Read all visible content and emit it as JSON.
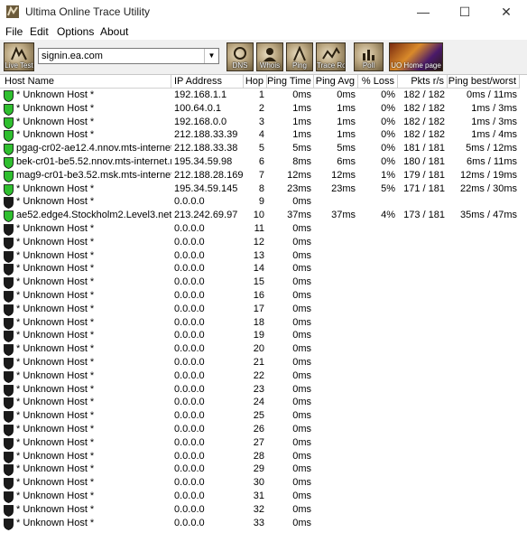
{
  "window": {
    "title": "Ultima Online Trace Utility"
  },
  "menu": [
    "File",
    "Edit",
    "Options",
    "About"
  ],
  "toolbar": {
    "buttons": [
      "Live Test",
      "DNS",
      "Whois",
      "Ping",
      "Trace Route",
      "Poll"
    ],
    "host_value": "signin.ea.com",
    "homepage_label": "UO Home page"
  },
  "columns": [
    "Host Name",
    "IP Address",
    "Hop",
    "Ping Time",
    "Ping Avg",
    "% Loss",
    "Pkts r/s",
    "Ping best/worst"
  ],
  "colors": {
    "status_ok": "#2fbf2f",
    "status_no": "#1a1a1a"
  },
  "rows": [
    {
      "status": "ok",
      "host": "* Unknown Host *",
      "ip": "192.168.1.1",
      "hop": "1",
      "time": "0ms",
      "avg": "0ms",
      "loss": "0%",
      "pkts": "182 / 182",
      "bw": "0ms / 11ms"
    },
    {
      "status": "ok",
      "host": "* Unknown Host *",
      "ip": "100.64.0.1",
      "hop": "2",
      "time": "1ms",
      "avg": "1ms",
      "loss": "0%",
      "pkts": "182 / 182",
      "bw": "1ms / 3ms"
    },
    {
      "status": "ok",
      "host": "* Unknown Host *",
      "ip": "192.168.0.0",
      "hop": "3",
      "time": "1ms",
      "avg": "1ms",
      "loss": "0%",
      "pkts": "182 / 182",
      "bw": "1ms / 3ms"
    },
    {
      "status": "ok",
      "host": "* Unknown Host *",
      "ip": "212.188.33.39",
      "hop": "4",
      "time": "1ms",
      "avg": "1ms",
      "loss": "0%",
      "pkts": "182 / 182",
      "bw": "1ms / 4ms"
    },
    {
      "status": "ok",
      "host": "pgag-cr02-ae12.4.nnov.mts-internet.net",
      "ip": "212.188.33.38",
      "hop": "5",
      "time": "5ms",
      "avg": "5ms",
      "loss": "0%",
      "pkts": "181 / 181",
      "bw": "5ms / 12ms"
    },
    {
      "status": "ok",
      "host": "bek-cr01-be5.52.nnov.mts-internet.net",
      "ip": "195.34.59.98",
      "hop": "6",
      "time": "8ms",
      "avg": "6ms",
      "loss": "0%",
      "pkts": "180 / 181",
      "bw": "6ms / 11ms"
    },
    {
      "status": "ok",
      "host": "mag9-cr01-be3.52.msk.mts-internet.net",
      "ip": "212.188.28.169",
      "hop": "7",
      "time": "12ms",
      "avg": "12ms",
      "loss": "1%",
      "pkts": "179 / 181",
      "bw": "12ms / 19ms"
    },
    {
      "status": "ok",
      "host": "* Unknown Host *",
      "ip": "195.34.59.145",
      "hop": "8",
      "time": "23ms",
      "avg": "23ms",
      "loss": "5%",
      "pkts": "171 / 181",
      "bw": "22ms / 30ms"
    },
    {
      "status": "no",
      "host": "* Unknown Host *",
      "ip": "0.0.0.0",
      "hop": "9",
      "time": "0ms",
      "avg": "",
      "loss": "",
      "pkts": "",
      "bw": ""
    },
    {
      "status": "ok",
      "host": "ae52.edge4.Stockholm2.Level3.net",
      "ip": "213.242.69.97",
      "hop": "10",
      "time": "37ms",
      "avg": "37ms",
      "loss": "4%",
      "pkts": "173 / 181",
      "bw": "35ms / 47ms"
    },
    {
      "status": "no",
      "host": "* Unknown Host *",
      "ip": "0.0.0.0",
      "hop": "11",
      "time": "0ms",
      "avg": "",
      "loss": "",
      "pkts": "",
      "bw": ""
    },
    {
      "status": "no",
      "host": "* Unknown Host *",
      "ip": "0.0.0.0",
      "hop": "12",
      "time": "0ms",
      "avg": "",
      "loss": "",
      "pkts": "",
      "bw": ""
    },
    {
      "status": "no",
      "host": "* Unknown Host *",
      "ip": "0.0.0.0",
      "hop": "13",
      "time": "0ms",
      "avg": "",
      "loss": "",
      "pkts": "",
      "bw": ""
    },
    {
      "status": "no",
      "host": "* Unknown Host *",
      "ip": "0.0.0.0",
      "hop": "14",
      "time": "0ms",
      "avg": "",
      "loss": "",
      "pkts": "",
      "bw": ""
    },
    {
      "status": "no",
      "host": "* Unknown Host *",
      "ip": "0.0.0.0",
      "hop": "15",
      "time": "0ms",
      "avg": "",
      "loss": "",
      "pkts": "",
      "bw": ""
    },
    {
      "status": "no",
      "host": "* Unknown Host *",
      "ip": "0.0.0.0",
      "hop": "16",
      "time": "0ms",
      "avg": "",
      "loss": "",
      "pkts": "",
      "bw": ""
    },
    {
      "status": "no",
      "host": "* Unknown Host *",
      "ip": "0.0.0.0",
      "hop": "17",
      "time": "0ms",
      "avg": "",
      "loss": "",
      "pkts": "",
      "bw": ""
    },
    {
      "status": "no",
      "host": "* Unknown Host *",
      "ip": "0.0.0.0",
      "hop": "18",
      "time": "0ms",
      "avg": "",
      "loss": "",
      "pkts": "",
      "bw": ""
    },
    {
      "status": "no",
      "host": "* Unknown Host *",
      "ip": "0.0.0.0",
      "hop": "19",
      "time": "0ms",
      "avg": "",
      "loss": "",
      "pkts": "",
      "bw": ""
    },
    {
      "status": "no",
      "host": "* Unknown Host *",
      "ip": "0.0.0.0",
      "hop": "20",
      "time": "0ms",
      "avg": "",
      "loss": "",
      "pkts": "",
      "bw": ""
    },
    {
      "status": "no",
      "host": "* Unknown Host *",
      "ip": "0.0.0.0",
      "hop": "21",
      "time": "0ms",
      "avg": "",
      "loss": "",
      "pkts": "",
      "bw": ""
    },
    {
      "status": "no",
      "host": "* Unknown Host *",
      "ip": "0.0.0.0",
      "hop": "22",
      "time": "0ms",
      "avg": "",
      "loss": "",
      "pkts": "",
      "bw": ""
    },
    {
      "status": "no",
      "host": "* Unknown Host *",
      "ip": "0.0.0.0",
      "hop": "23",
      "time": "0ms",
      "avg": "",
      "loss": "",
      "pkts": "",
      "bw": ""
    },
    {
      "status": "no",
      "host": "* Unknown Host *",
      "ip": "0.0.0.0",
      "hop": "24",
      "time": "0ms",
      "avg": "",
      "loss": "",
      "pkts": "",
      "bw": ""
    },
    {
      "status": "no",
      "host": "* Unknown Host *",
      "ip": "0.0.0.0",
      "hop": "25",
      "time": "0ms",
      "avg": "",
      "loss": "",
      "pkts": "",
      "bw": ""
    },
    {
      "status": "no",
      "host": "* Unknown Host *",
      "ip": "0.0.0.0",
      "hop": "26",
      "time": "0ms",
      "avg": "",
      "loss": "",
      "pkts": "",
      "bw": ""
    },
    {
      "status": "no",
      "host": "* Unknown Host *",
      "ip": "0.0.0.0",
      "hop": "27",
      "time": "0ms",
      "avg": "",
      "loss": "",
      "pkts": "",
      "bw": ""
    },
    {
      "status": "no",
      "host": "* Unknown Host *",
      "ip": "0.0.0.0",
      "hop": "28",
      "time": "0ms",
      "avg": "",
      "loss": "",
      "pkts": "",
      "bw": ""
    },
    {
      "status": "no",
      "host": "* Unknown Host *",
      "ip": "0.0.0.0",
      "hop": "29",
      "time": "0ms",
      "avg": "",
      "loss": "",
      "pkts": "",
      "bw": ""
    },
    {
      "status": "no",
      "host": "* Unknown Host *",
      "ip": "0.0.0.0",
      "hop": "30",
      "time": "0ms",
      "avg": "",
      "loss": "",
      "pkts": "",
      "bw": ""
    },
    {
      "status": "no",
      "host": "* Unknown Host *",
      "ip": "0.0.0.0",
      "hop": "31",
      "time": "0ms",
      "avg": "",
      "loss": "",
      "pkts": "",
      "bw": ""
    },
    {
      "status": "no",
      "host": "* Unknown Host *",
      "ip": "0.0.0.0",
      "hop": "32",
      "time": "0ms",
      "avg": "",
      "loss": "",
      "pkts": "",
      "bw": ""
    },
    {
      "status": "no",
      "host": "* Unknown Host *",
      "ip": "0.0.0.0",
      "hop": "33",
      "time": "0ms",
      "avg": "",
      "loss": "",
      "pkts": "",
      "bw": ""
    }
  ]
}
